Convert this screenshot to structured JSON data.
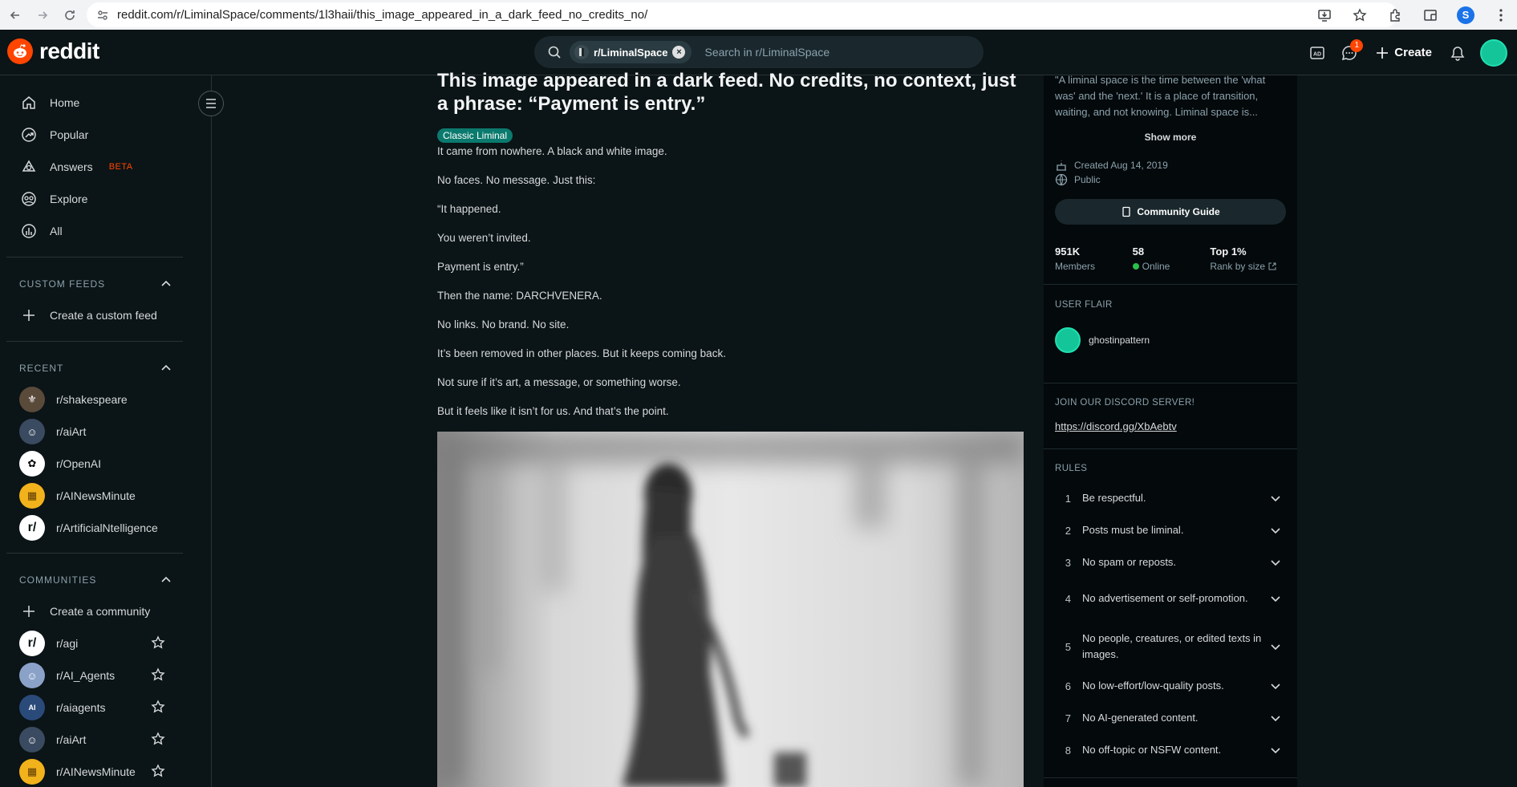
{
  "browser": {
    "url": "reddit.com/r/LiminalSpace/comments/1l3haii/this_image_appeared_in_a_dark_feed_no_credits_no/",
    "profile_initial": "S"
  },
  "header": {
    "logo_text": "reddit",
    "search_chip": "r/LiminalSpace",
    "search_placeholder": "Search in r/LiminalSpace",
    "chat_badge": "1",
    "create_label": "Create"
  },
  "sidebar": {
    "nav": [
      {
        "label": "Home",
        "icon": "home-icon"
      },
      {
        "label": "Popular",
        "icon": "popular-icon"
      },
      {
        "label": "Answers",
        "icon": "answers-icon",
        "badge": "BETA"
      },
      {
        "label": "Explore",
        "icon": "explore-icon"
      },
      {
        "label": "All",
        "icon": "all-icon"
      }
    ],
    "custom_feeds_heading": "CUSTOM FEEDS",
    "create_custom_feed": "Create a custom feed",
    "recent_heading": "RECENT",
    "recent": [
      "r/shakespeare",
      "r/aiArt",
      "r/OpenAI",
      "r/AINewsMinute",
      "r/ArtificialNtelligence"
    ],
    "communities_heading": "COMMUNITIES",
    "create_community": "Create a community",
    "communities": [
      "r/agi",
      "r/AI_Agents",
      "r/aiagents",
      "r/aiArt",
      "r/AINewsMinute"
    ]
  },
  "post": {
    "title": "This image appeared in a dark feed. No credits, no context, just a phrase: “Payment is entry.”",
    "flair": "Classic Liminal",
    "paragraphs": [
      "It came from nowhere. A black and white image.",
      "No faces. No message. Just this:",
      "“It happened.",
      "You weren’t invited.",
      "Payment is entry.”",
      "Then the name: DARCHVENERA.",
      "No links. No brand. No site.",
      "It’s been removed in other places. But it keeps coming back.",
      "Not sure if it’s art, a message, or something worse.",
      "But it feels like it isn’t for us. And that’s the point."
    ]
  },
  "community": {
    "description": "\"A liminal space is the time between the 'what was' and the 'next.' It is a place of transition, waiting, and not knowing. Liminal space is...",
    "show_more": "Show more",
    "created": "Created Aug 14, 2019",
    "visibility": "Public",
    "guide_label": "Community Guide",
    "stats": [
      {
        "value": "951K",
        "label": "Members"
      },
      {
        "value": "58",
        "label": "Online"
      },
      {
        "value": "Top 1%",
        "label": "Rank by size"
      }
    ],
    "user_flair_heading": "USER FLAIR",
    "user_flair_name": "ghostinpattern",
    "discord_heading": "JOIN OUR DISCORD SERVER!",
    "discord_link": "https://discord.gg/XbAebtv",
    "rules_heading": "RULES",
    "rules": [
      {
        "n": "1",
        "text": "Be respectful."
      },
      {
        "n": "2",
        "text": "Posts must be liminal."
      },
      {
        "n": "3",
        "text": "No spam or reposts."
      },
      {
        "n": "4",
        "text": "No advertisement or self-promotion."
      },
      {
        "n": "5",
        "text": "No people, creatures, or edited texts in images."
      },
      {
        "n": "6",
        "text": "No low-effort/low-quality posts."
      },
      {
        "n": "7",
        "text": "No AI-generated content."
      },
      {
        "n": "8",
        "text": "No off-topic or NSFW content."
      }
    ]
  },
  "colors": {
    "background": "#0b1416",
    "accent": "#ff4500",
    "flair": "#0b7a6e",
    "online": "#2bc04a"
  }
}
